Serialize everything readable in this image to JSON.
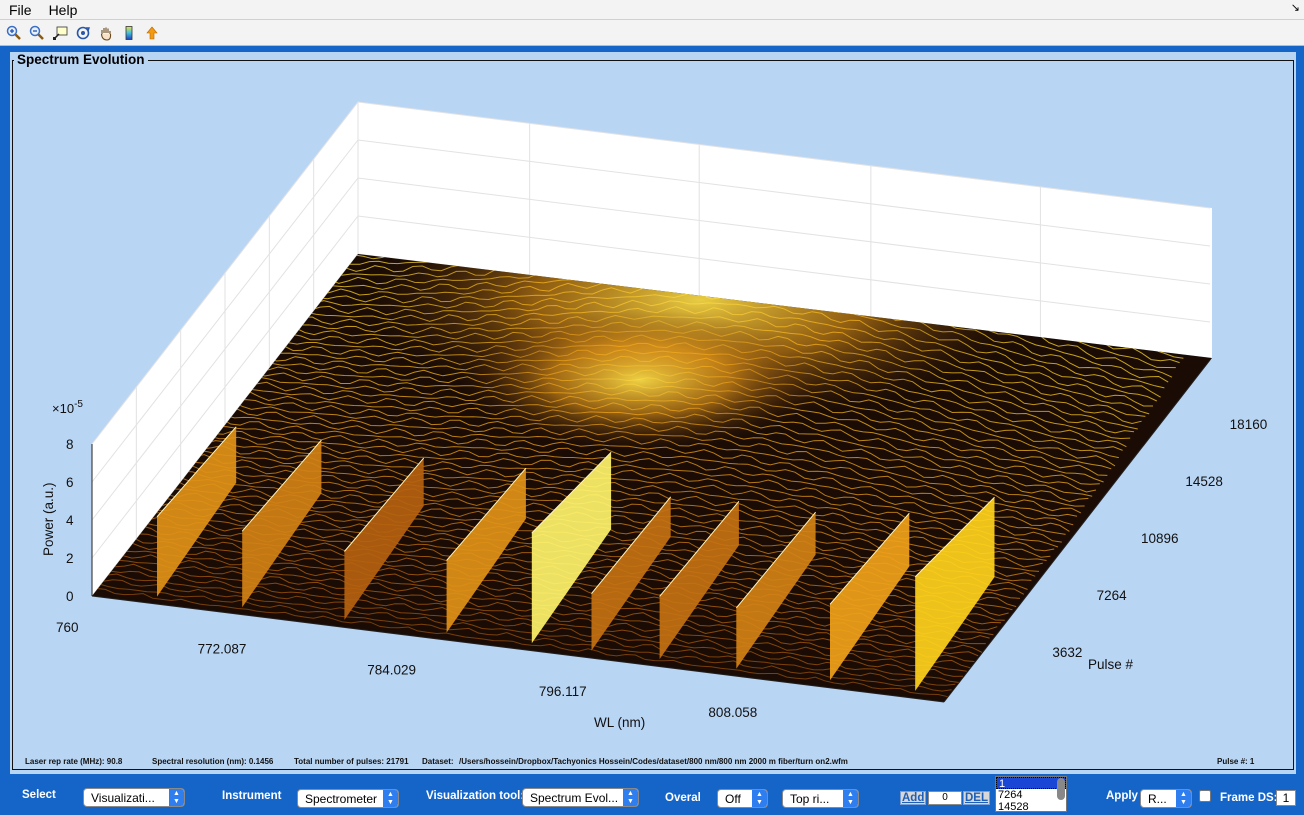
{
  "menu": {
    "items": [
      "File",
      "Help"
    ]
  },
  "toolbar": {
    "tools": [
      "zoom-in-icon",
      "zoom-out-icon",
      "data-cursor-icon",
      "rotate-3d-icon",
      "pan-hand-icon",
      "colorbar-icon",
      "export-arrow-icon"
    ]
  },
  "panel": {
    "title": "Spectrum Evolution"
  },
  "chart_data": {
    "type": "surface",
    "zlabel": "Power (a.u.)",
    "zexponent": "×10",
    "zexponent_power": "-5",
    "xlabel": "WL (nm)",
    "ylabel": "Pulse #",
    "x_ticks": [
      "760",
      "772.087",
      "784.029",
      "796.117",
      "808.058"
    ],
    "y_ticks": [
      "3632",
      "7264",
      "10896",
      "14528",
      "18160"
    ],
    "z_ticks": [
      "0",
      "2",
      "4",
      "6",
      "8"
    ],
    "xlim": [
      760,
      820
    ],
    "ylim": [
      0,
      21791
    ],
    "zlim": [
      0,
      8
    ],
    "grid": true,
    "colormap": [
      "#160a04",
      "#5a2a0c",
      "#b5620f",
      "#f0a21a",
      "#ffd21c",
      "#ffff88"
    ]
  },
  "info": {
    "rep_rate": "Laser rep rate (MHz): 90.8",
    "resolution": "Spectral resolution (nm): 0.1456",
    "pulses": "Total number of pulses: 21791",
    "dataset_label": "Dataset:",
    "dataset_path": "/Users/hossein/Dropbox/Tachyonics Hossein/Codes/dataset/800 nm/800 nm 2000 m fiber/turn on2.wfm",
    "pulse_no": "Pulse #: 1"
  },
  "controls": {
    "select_label": "Select",
    "select_value": "Visualizati...",
    "instrument_label": "Instrument",
    "instrument_value": "Spectrometer",
    "vis_tool_label": "Visualization tool:",
    "vis_tool_value": "Spectrum Evol...",
    "overal_label": "Overal",
    "overal_value": "Off",
    "position_value": "Top ri...",
    "add_label": "Add",
    "add_value": "0",
    "del_label": "DEL",
    "list_items": [
      "1",
      "7264",
      "14528"
    ],
    "apply_label": "Apply",
    "apply_value": "R...",
    "frame_ds_label": "Frame DS:",
    "frame_ds_value": "1"
  }
}
